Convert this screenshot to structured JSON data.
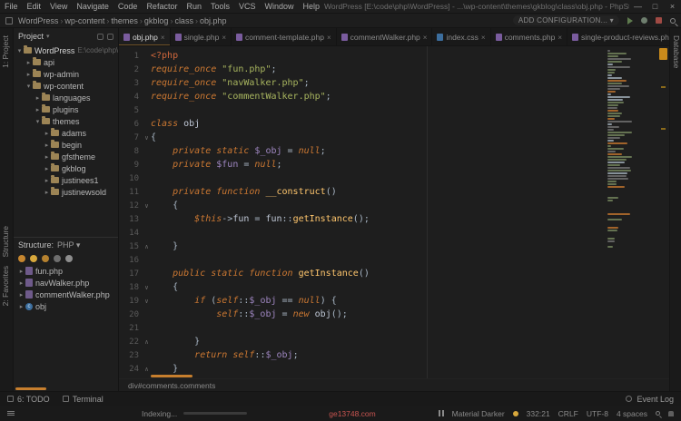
{
  "window": {
    "menus": [
      "File",
      "Edit",
      "View",
      "Navigate",
      "Code",
      "Refactor",
      "Run",
      "Tools",
      "VCS",
      "Window",
      "Help"
    ],
    "title": "WordPress [E:\\code\\php\\WordPress] - ...\\wp-content\\themes\\gkblog\\class\\obj.php - PhpStorm (Administrator)",
    "controls": {
      "minimize": "—",
      "maximize": "□",
      "close": "×"
    }
  },
  "toolbar": {
    "breadcrumbs": [
      "WordPress",
      "wp-content",
      "themes",
      "gkblog",
      "class",
      "obj.php"
    ],
    "add_configuration": "ADD CONFIGURATION..."
  },
  "left_stripe": {
    "project": "1: Project",
    "structure": "Structure",
    "favorites": "2: Favorites"
  },
  "right_stripe": {
    "database": "Database"
  },
  "project_panel": {
    "header": "Project",
    "tree": [
      {
        "label": "WordPress",
        "path": "E:\\code\\php\\WordPress",
        "level": 0,
        "state": "open"
      },
      {
        "label": "api",
        "level": 1,
        "state": "closed"
      },
      {
        "label": "wp-admin",
        "level": 1,
        "state": "closed"
      },
      {
        "label": "wp-content",
        "level": 1,
        "state": "open"
      },
      {
        "label": "languages",
        "level": 2,
        "state": "closed"
      },
      {
        "label": "plugins",
        "level": 2,
        "state": "closed"
      },
      {
        "label": "themes",
        "level": 2,
        "state": "open"
      },
      {
        "label": "adams",
        "level": 3,
        "state": "closed"
      },
      {
        "label": "begin",
        "level": 3,
        "state": "closed"
      },
      {
        "label": "gfstheme",
        "level": 3,
        "state": "closed"
      },
      {
        "label": "gkblog",
        "level": 3,
        "state": "closed"
      },
      {
        "label": "justinees1",
        "level": 3,
        "state": "closed"
      },
      {
        "label": "justinewsold",
        "level": 3,
        "state": "closed"
      }
    ]
  },
  "structure_panel": {
    "label": "Structure:",
    "filter": "PHP",
    "toolbar_icons": [
      {
        "name": "sort-alphabetically",
        "color": "#C6862F"
      },
      {
        "name": "sort-by-visibility",
        "color": "#D8A83C"
      },
      {
        "name": "show-fields",
        "color": "#B5812F"
      },
      {
        "name": "show-inherited",
        "color": "#6E6E6E"
      },
      {
        "name": "expand-all",
        "color": "#8E8E8E"
      }
    ],
    "items": [
      {
        "label": "fun.php",
        "icon": "php-include"
      },
      {
        "label": "navWalker.php",
        "icon": "php-include"
      },
      {
        "label": "commentWalker.php",
        "icon": "php-include"
      },
      {
        "label": "obj",
        "icon": "class"
      }
    ]
  },
  "tabs": [
    {
      "label": "obj.php",
      "type": "php",
      "active": true
    },
    {
      "label": "single.php",
      "type": "php",
      "active": false
    },
    {
      "label": "comment-template.php",
      "type": "php",
      "active": false
    },
    {
      "label": "commentWalker.php",
      "type": "php",
      "active": false
    },
    {
      "label": "index.css",
      "type": "css",
      "active": false
    },
    {
      "label": "comments.php",
      "type": "php",
      "active": false
    },
    {
      "label": "single-product-reviews.php",
      "type": "php",
      "active": false
    }
  ],
  "editor": {
    "breadcrumb": "div#comments.comments",
    "lines": [
      {
        "n": 1,
        "f": null,
        "t": [
          [
            "tag",
            "<?php"
          ]
        ]
      },
      {
        "n": 2,
        "f": null,
        "t": [
          [
            "k",
            "require_once "
          ],
          [
            "s",
            "\"fun.php\""
          ],
          [
            "p",
            ";"
          ]
        ]
      },
      {
        "n": 3,
        "f": null,
        "t": [
          [
            "k",
            "require_once "
          ],
          [
            "s",
            "\"navWalker.php\""
          ],
          [
            "p",
            ";"
          ]
        ]
      },
      {
        "n": 4,
        "f": null,
        "t": [
          [
            "k",
            "require_once "
          ],
          [
            "s",
            "\"commentWalker.php\""
          ],
          [
            "p",
            ";"
          ]
        ]
      },
      {
        "n": 5,
        "f": null,
        "t": []
      },
      {
        "n": 6,
        "f": null,
        "t": [
          [
            "k",
            "class "
          ],
          [
            "cls",
            "obj"
          ]
        ]
      },
      {
        "n": 7,
        "f": "v",
        "t": [
          [
            "p",
            "{"
          ]
        ]
      },
      {
        "n": 8,
        "f": null,
        "t": [
          [
            "p",
            "    "
          ],
          [
            "k",
            "private static "
          ],
          [
            "v",
            "$_obj"
          ],
          [
            "p",
            " = "
          ],
          [
            "k",
            "null"
          ],
          [
            "p",
            ";"
          ]
        ]
      },
      {
        "n": 9,
        "f": null,
        "t": [
          [
            "p",
            "    "
          ],
          [
            "k",
            "private "
          ],
          [
            "v",
            "$fun"
          ],
          [
            "p",
            " = "
          ],
          [
            "k",
            "null"
          ],
          [
            "p",
            ";"
          ]
        ]
      },
      {
        "n": 10,
        "f": null,
        "t": []
      },
      {
        "n": 11,
        "f": null,
        "t": [
          [
            "p",
            "    "
          ],
          [
            "k",
            "private function "
          ],
          [
            "f",
            "__construct"
          ],
          [
            "p",
            "()"
          ]
        ]
      },
      {
        "n": 12,
        "f": "v",
        "t": [
          [
            "p",
            "    {"
          ]
        ]
      },
      {
        "n": 13,
        "f": null,
        "t": [
          [
            "p",
            "        "
          ],
          [
            "this",
            "$this"
          ],
          [
            "p",
            "->"
          ],
          [
            "prop",
            "fun"
          ],
          [
            "p",
            " = "
          ],
          [
            "cls",
            "fun"
          ],
          [
            "p",
            "::"
          ],
          [
            "f",
            "getInstance"
          ],
          [
            "p",
            "();"
          ]
        ]
      },
      {
        "n": 14,
        "f": null,
        "t": []
      },
      {
        "n": 15,
        "f": "^",
        "t": [
          [
            "p",
            "    }"
          ]
        ]
      },
      {
        "n": 16,
        "f": null,
        "t": []
      },
      {
        "n": 17,
        "f": null,
        "t": [
          [
            "p",
            "    "
          ],
          [
            "k",
            "public static function "
          ],
          [
            "f",
            "getInstance"
          ],
          [
            "p",
            "()"
          ]
        ]
      },
      {
        "n": 18,
        "f": "v",
        "t": [
          [
            "p",
            "    {"
          ]
        ]
      },
      {
        "n": 19,
        "f": "v",
        "t": [
          [
            "p",
            "        "
          ],
          [
            "k",
            "if "
          ],
          [
            "p",
            "("
          ],
          [
            "k",
            "self"
          ],
          [
            "p",
            "::"
          ],
          [
            "v",
            "$_obj"
          ],
          [
            "p",
            " == "
          ],
          [
            "k",
            "null"
          ],
          [
            "p",
            ") {"
          ]
        ]
      },
      {
        "n": 20,
        "f": null,
        "t": [
          [
            "p",
            "            "
          ],
          [
            "k",
            "self"
          ],
          [
            "p",
            "::"
          ],
          [
            "v",
            "$_obj"
          ],
          [
            "p",
            " = "
          ],
          [
            "k",
            "new "
          ],
          [
            "cls",
            "obj"
          ],
          [
            "p",
            "();"
          ]
        ]
      },
      {
        "n": 21,
        "f": null,
        "t": []
      },
      {
        "n": 22,
        "f": "^",
        "t": [
          [
            "p",
            "        }"
          ]
        ]
      },
      {
        "n": 23,
        "f": null,
        "t": [
          [
            "p",
            "        "
          ],
          [
            "k",
            "return "
          ],
          [
            "k",
            "self"
          ],
          [
            "p",
            "::"
          ],
          [
            "v",
            "$_obj"
          ],
          [
            "p",
            ";"
          ]
        ]
      },
      {
        "n": 24,
        "f": "^",
        "t": [
          [
            "p",
            "    }"
          ]
        ]
      }
    ]
  },
  "bottom_bar": {
    "todo": "6: TODO",
    "terminal": "Terminal",
    "event_log": "Event Log"
  },
  "status_bar": {
    "indexing": "Indexing...",
    "progress_pct": 45,
    "alert": "ge13748.com",
    "theme": "Material Darker",
    "caret": "332:21",
    "line_ending": "CRLF",
    "encoding": "UTF-8",
    "indent": "4 spaces"
  },
  "icons": {
    "arrow_open": "▾",
    "arrow_closed": "▸",
    "dropdown": "▾",
    "separator": "›",
    "tab_close": "×",
    "fold_open": "∨",
    "fold_close": "∧",
    "class_letter": "c"
  },
  "colors": {
    "accent_orange": "#C77F2E",
    "alert_red": "#C75450",
    "progress": "#D8A83C"
  }
}
